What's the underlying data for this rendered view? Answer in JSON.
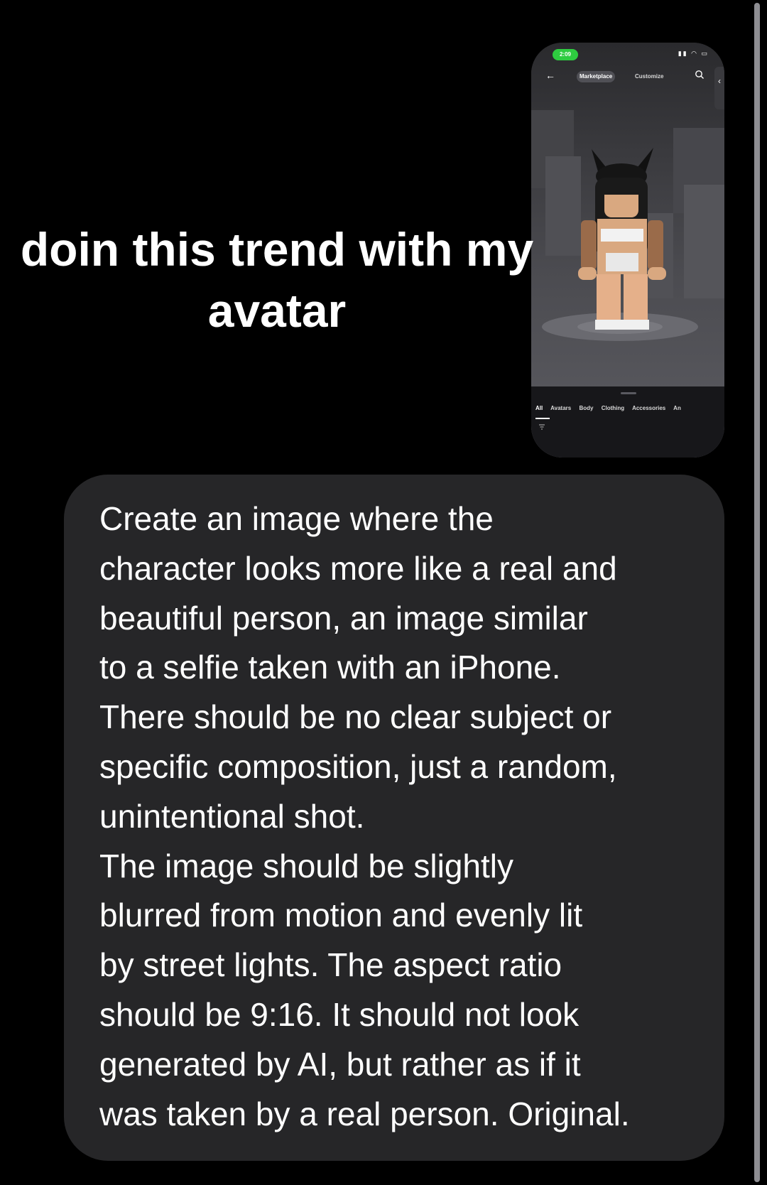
{
  "caption": {
    "text": "doin this trend with my avatar"
  },
  "phone_screenshot": {
    "status_time": "2:09",
    "tabs": [
      {
        "label": "Marketplace",
        "active": true
      },
      {
        "label": "Customize",
        "active": false
      }
    ],
    "categories": [
      "All",
      "Avatars",
      "Body",
      "Clothing",
      "Accessories",
      "An"
    ],
    "active_category": "All",
    "colors": {
      "status_pill": "#2ecc40",
      "backdrop": "#3b3b3f",
      "bottom_sheet": "#17171a"
    }
  },
  "message": {
    "text": "Create an image where the\ncharacter looks more like a real and\nbeautiful person, an image similar\nto a selfie taken with an iPhone.\nThere should be no clear subject or\nspecific composition, just a random,\nunintentional shot.\nThe image should be slightly\nblurred from motion and evenly lit\nby street lights. The aspect ratio\nshould be 9:16. It should not look\ngenerated by AI, but rather as if it\nwas taken by a real person. Original.",
    "bubble_color": "#262628"
  }
}
